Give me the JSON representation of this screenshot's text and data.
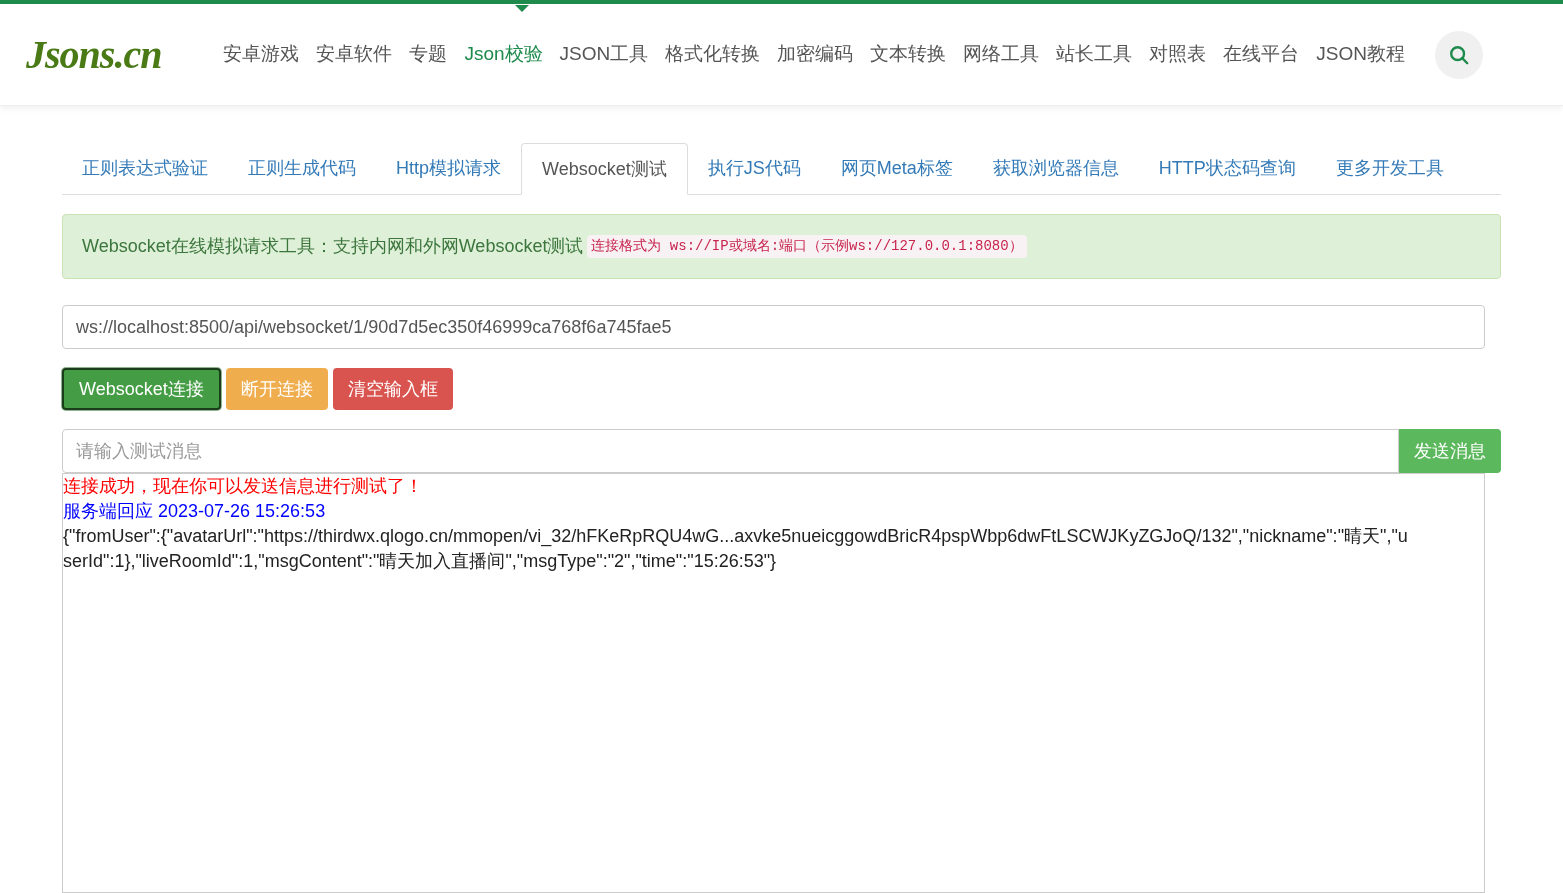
{
  "logo": "Jsons.cn",
  "nav": [
    {
      "label": "安卓游戏",
      "selected": false
    },
    {
      "label": "安卓软件",
      "selected": false
    },
    {
      "label": "专题",
      "selected": false
    },
    {
      "label": "Json校验",
      "selected": true
    },
    {
      "label": "JSON工具",
      "selected": false
    },
    {
      "label": "格式化转换",
      "selected": false
    },
    {
      "label": "加密编码",
      "selected": false
    },
    {
      "label": "文本转换",
      "selected": false
    },
    {
      "label": "网络工具",
      "selected": false
    },
    {
      "label": "站长工具",
      "selected": false
    },
    {
      "label": "对照表",
      "selected": false
    },
    {
      "label": "在线平台",
      "selected": false
    },
    {
      "label": "JSON教程",
      "selected": false
    }
  ],
  "tabs": [
    {
      "label": "正则表达式验证",
      "selected": false
    },
    {
      "label": "正则生成代码",
      "selected": false
    },
    {
      "label": "Http模拟请求",
      "selected": false
    },
    {
      "label": "Websocket测试",
      "selected": true
    },
    {
      "label": "执行JS代码",
      "selected": false
    },
    {
      "label": "网页Meta标签",
      "selected": false
    },
    {
      "label": "获取浏览器信息",
      "selected": false
    },
    {
      "label": "HTTP状态码查询",
      "selected": false
    },
    {
      "label": "更多开发工具",
      "selected": false
    }
  ],
  "notice": {
    "text": "Websocket在线模拟请求工具：支持内网和外网Websocket测试",
    "code": "连接格式为 ws://IP或域名:端口（示例ws://127.0.0.1:8080）"
  },
  "url_field": {
    "value": "ws://localhost:8500/api/websocket/1/90d7d5ec350f46999ca768f6a745fae5"
  },
  "buttons": [
    {
      "label": "Websocket连接",
      "kind": "connect",
      "focused": true
    },
    {
      "label": "断开连接",
      "kind": "disconnect",
      "focused": false
    },
    {
      "label": "清空输入框",
      "kind": "clear",
      "focused": false
    }
  ],
  "message_field": {
    "placeholder": "请输入测试消息"
  },
  "send_button": "发送消息",
  "log": [
    {
      "kind": "status",
      "text": "连接成功，现在你可以发送信息进行测试了！"
    },
    {
      "kind": "reply",
      "text": "服务端回应 2023-07-26 15:26:53"
    },
    {
      "kind": "data",
      "text": "{\"fromUser\":{\"avatarUrl\":\"https://thirdwx.qlogo.cn/mmopen/vi_32/hFKeRpRQU4wG...axvke5nueicggowdBricR4pspWbp6dwFtLSCWJKyZGJoQ/132\",\"nickname\":\"晴天\",\"userId\":1},\"liveRoomId\":1,\"msgContent\":\"晴天加入直播间\",\"msgType\":\"2\",\"time\":\"15:26:53\"}"
    }
  ]
}
